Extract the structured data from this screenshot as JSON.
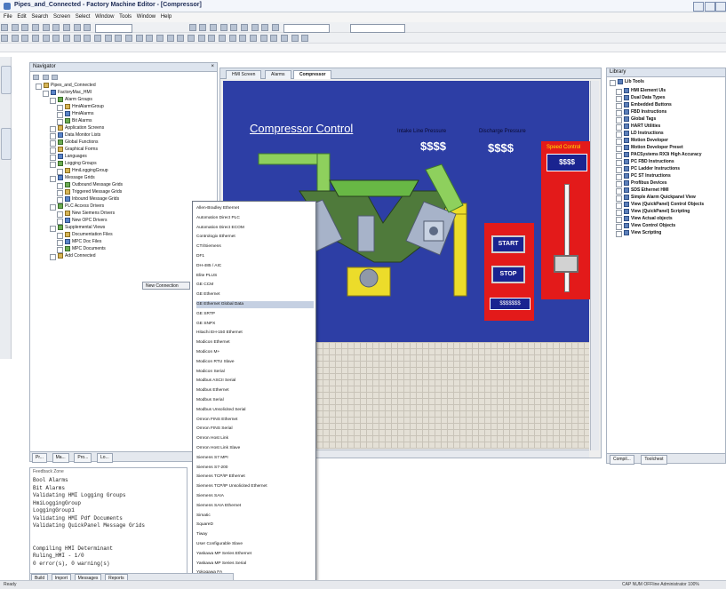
{
  "window": {
    "title": "Pipes_and_Connected - Factory Machine Editor - [Compressor]"
  },
  "menu": [
    "File",
    "Edit",
    "Search",
    "Screen",
    "Select",
    "Window",
    "Tools",
    "Window",
    "Help"
  ],
  "navigator": {
    "title": "Navigator",
    "close": "×",
    "items": [
      {
        "label": "Pipes_and_Connected"
      },
      {
        "label": "FactoryMac_HMI"
      },
      {
        "label": "Alarm Groups"
      },
      {
        "label": "HmiAlarmGroup"
      },
      {
        "label": "HmiAlarms"
      },
      {
        "label": "Bit Alarms"
      },
      {
        "label": "Application Screens"
      },
      {
        "label": "Data Monitor Lists"
      },
      {
        "label": "Global Functions"
      },
      {
        "label": "Graphical Forms"
      },
      {
        "label": "Languages"
      },
      {
        "label": "Logging Groups"
      },
      {
        "label": "HmiLoggingGroup"
      },
      {
        "label": "Message Grids"
      },
      {
        "label": "Outbound Message Grids"
      },
      {
        "label": "Triggered Message Grids"
      },
      {
        "label": "Inbound Message Grids"
      },
      {
        "label": "PLC Access Drivers"
      },
      {
        "label": "New Siemens Drivers"
      },
      {
        "label": "New OPC Drivers"
      },
      {
        "label": "Supplemental Views"
      },
      {
        "label": "Documentation Files"
      },
      {
        "label": "MPC Doc Files"
      },
      {
        "label": "MPC Documents"
      },
      {
        "label": "Add Connected"
      }
    ]
  },
  "new_tag": "New Connection",
  "nav_bottom_tabs": [
    "Pr...",
    "Ma...",
    "Pro...",
    "Lo..."
  ],
  "doc_tabs": [
    "HMI Screen",
    "Alarms",
    "Compressor"
  ],
  "screen": {
    "title": "Compressor Control",
    "label_1": "Intake Line Pressure",
    "label_2": "Discharge Pressure",
    "value_1": "$$$$",
    "value_2": "$$$$",
    "speed_header": "Speed Control",
    "speed_value": "$$$$",
    "start": "START",
    "stop": "STOP",
    "status_value": "$$$$$$$"
  },
  "context_menu": {
    "items": [
      "Allen-Bradley Ethernet",
      "Automation Direct PLC",
      "Automation Direct ECOM",
      "Contrologix Ethernet",
      "CTI/Siemens",
      "DF1",
      "DH-485 / AIC",
      "Elite PLUS",
      "GE CCM",
      "GE Ethernet",
      "GE Ethernet Global Data",
      "GE SRTP",
      "GE SNPX",
      "Hitachi EH-150 Ethernet",
      "Modicon Ethernet",
      "Modicon M+",
      "Modicon RTU Slave",
      "Modicon Serial",
      "Modbus ASCII Serial",
      "Modbus Ethernet",
      "Modbus Serial",
      "Modbus Unsolicited Serial",
      "Omron FINS Ethernet",
      "Omron FINS Serial",
      "Omron Host Link",
      "Omron Host Link Slave",
      "Siemens S7 MPI",
      "Siemens S7-200",
      "Siemens TCP/IP Ethernet",
      "Siemens TCP/IP Unsolicited Ethernet",
      "Siemens SAIA",
      "Siemens SAIA Ethernet",
      "Simatic",
      "SquareD",
      "Tiway",
      "User Configurable Slave",
      "Yaskawa MP Series Ethernet",
      "Yaskawa MP Series Serial",
      "Yokogawa FA",
      "Yokogawa FA Serial"
    ],
    "selected_index": 10
  },
  "library": {
    "header": "Library",
    "root": "Lib Tools",
    "items": [
      "HMI Element UIs",
      "Dual Data Types",
      "Embedded Buttons",
      "FBD Instructions",
      "Global Tags",
      "HART Utilities",
      "LD Instructions",
      "Motion Developer",
      "Motion Developer Preset",
      "PACSystems RX3i High Accuracy",
      "PC FBD Instructions",
      "PC Ladder Instructions",
      "PC ST Instructions",
      "Profibus Devices",
      "SDS Ethernet HMI",
      "Simple Alarm Quickpanel View",
      "View (QuickPanel) Control Objects",
      "View (QuickPanel) Scripting",
      "View Actual objects",
      "View Control Objects",
      "View Scripting"
    ],
    "bottom_tabs": [
      "Compil...",
      "Toolchest"
    ]
  },
  "output": {
    "title": "Feedback Zone",
    "lines": [
      "Bool Alarms",
      "Bit Alarms",
      "Validating HMI Logging Groups",
      "HmiLoggingGroup",
      "LoggingGroup1",
      "Validating HMI Pdf Documents",
      "Validating QuickPanel Message Grids",
      "",
      "",
      "Compiling HMI Determinant",
      "Ruling_HMI - 1/0",
      "0 error(s), 0 warning(s)"
    ],
    "tabs": [
      "Build",
      "Import",
      "Messages",
      "Reports"
    ]
  },
  "status": {
    "left": "Ready",
    "right": "CAP NUM OFFline  Administrator  100%"
  },
  "colors": {
    "screen_bg": "#2d3ea5",
    "panel_red": "#e31a1a",
    "pipe_green": "#8ed05d",
    "pipe_yellow": "#ecdc2a"
  }
}
